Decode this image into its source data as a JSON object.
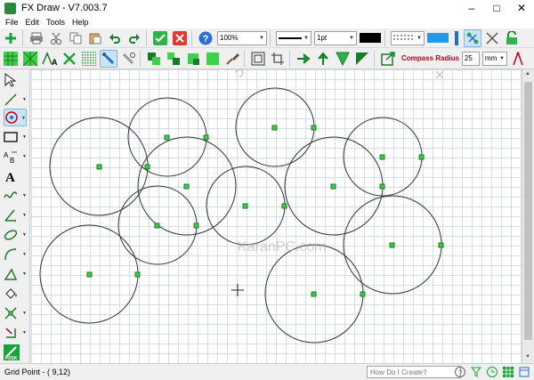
{
  "window": {
    "title": "FX Draw - V7.003.7"
  },
  "menu": [
    "File",
    "Edit",
    "Tools",
    "Help"
  ],
  "toolbar": {
    "zoom": "100%",
    "line_width": "1pt",
    "compass_radius_label": "Compass Radius",
    "compass_radius_value": "25",
    "compass_unit": "mm"
  },
  "status": {
    "grid_point": "Grid Point - ( 9,12)",
    "help_placeholder": "How Do I Create?"
  },
  "watermark": "KaranPC.com",
  "colors": {
    "accent_green": "#1aa33a",
    "point_fill": "#3ecf3e",
    "grid_line": "#d6dce8",
    "circle_stroke": "#333333",
    "compass_label": "#c0001a"
  },
  "icons": {
    "toolbar1": [
      "add-icon",
      "print-icon",
      "cut-icon",
      "copy-icon",
      "paste-icon",
      "undo-icon",
      "redo-icon",
      "ok-icon",
      "cancel-icon",
      "help-icon"
    ],
    "toolbar2": [
      "grid-icon",
      "iso-grid-icon",
      "text-size-icon",
      "cross-icon",
      "dot-grid-icon",
      "snap-icon",
      "link-icon",
      "group-icon",
      "ungroup-icon",
      "bring-front-icon",
      "send-back-icon",
      "brush-icon",
      "frame-icon",
      "crop-icon",
      "arrow-right-icon",
      "arrow-up-icon",
      "arrow-diag-icon",
      "arrow-corner-icon",
      "export-icon",
      "compass-icon"
    ],
    "left_tools": [
      "select-tool",
      "line-tool",
      "compass-tool",
      "rectangle-tool",
      "label-tool",
      "text-tool",
      "curve-tool",
      "angle-tool",
      "ellipse-tool",
      "arc-tool",
      "triangle-tool",
      "fill-tool",
      "intersect-tool",
      "transform-tool",
      "fxsk-logo"
    ]
  }
}
